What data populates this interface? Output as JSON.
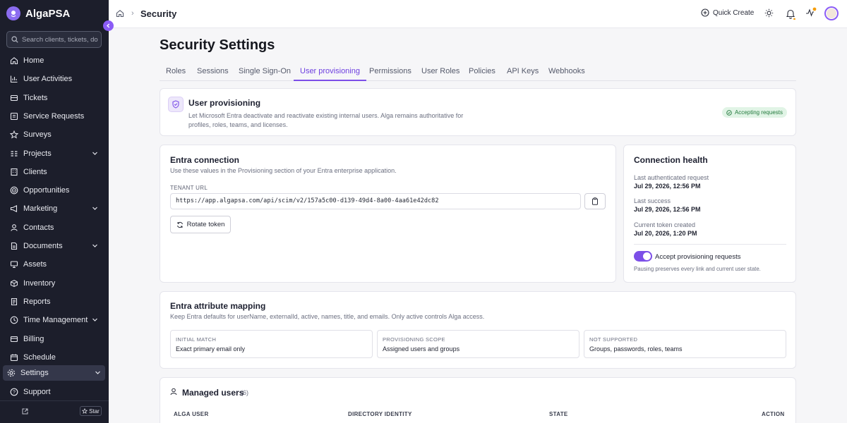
{
  "brand": {
    "name": "AlgaPSA"
  },
  "search": {
    "placeholder": "Search clients, tickets, documents..."
  },
  "sidebar": {
    "items": [
      {
        "label": "Home",
        "icon": "home-icon"
      },
      {
        "label": "User Activities",
        "icon": "chart-icon"
      },
      {
        "label": "Tickets",
        "icon": "ticket-icon"
      },
      {
        "label": "Service Requests",
        "icon": "service-icon"
      },
      {
        "label": "Surveys",
        "icon": "star-icon"
      },
      {
        "label": "Projects",
        "icon": "projects-icon",
        "expandable": true
      },
      {
        "label": "Clients",
        "icon": "building-icon"
      },
      {
        "label": "Opportunities",
        "icon": "target-icon"
      },
      {
        "label": "Marketing",
        "icon": "megaphone-icon",
        "expandable": true
      },
      {
        "label": "Contacts",
        "icon": "contacts-icon"
      },
      {
        "label": "Documents",
        "icon": "document-icon",
        "expandable": true
      },
      {
        "label": "Assets",
        "icon": "monitor-icon"
      },
      {
        "label": "Inventory",
        "icon": "box-icon"
      },
      {
        "label": "Reports",
        "icon": "report-icon"
      },
      {
        "label": "Time Management",
        "icon": "clock-icon",
        "expandable": true
      },
      {
        "label": "Billing",
        "icon": "billing-icon"
      },
      {
        "label": "Schedule",
        "icon": "calendar-icon"
      }
    ],
    "settings": {
      "label": "Settings"
    },
    "support": {
      "label": "Support"
    },
    "star": {
      "label": "Star"
    }
  },
  "header": {
    "title": "Security",
    "quick_create": "Quick Create"
  },
  "page": {
    "title": "Security Settings"
  },
  "tabs": [
    "Roles",
    "Sessions",
    "Single Sign-On",
    "User provisioning",
    "Permissions",
    "User Roles",
    "Policies",
    "API Keys",
    "Webhooks"
  ],
  "active_tab": "User provisioning",
  "provisioning": {
    "title": "User provisioning",
    "description_line1": "Let Microsoft Entra deactivate and reactivate existing internal users. Alga remains authoritative for",
    "description_line2": "profiles, roles, teams, and licenses.",
    "badge": "Accepting requests"
  },
  "entra": {
    "title": "Entra connection",
    "subtitle": "Use these values in the Provisioning section of your Entra enterprise application.",
    "tenant_url_label": "TENANT URL",
    "tenant_url": "https://app.algapsa.com/api/scim/v2/157a5c00-d139-49d4-8a00-4aa61e42dc82",
    "rotate_label": "Rotate token"
  },
  "health": {
    "title": "Connection health",
    "last_auth_label": "Last authenticated request",
    "last_auth_value": "Jul 29, 2026, 12:56 PM",
    "last_success_label": "Last success",
    "last_success_value": "Jul 29, 2026, 12:56 PM",
    "token_created_label": "Current token created",
    "token_created_value": "Jul 20, 2026, 1:20 PM",
    "toggle_label": "Accept provisioning requests",
    "toggle_on": true,
    "toggle_hint": "Pausing preserves every link and current user state."
  },
  "mapping": {
    "title": "Entra attribute mapping",
    "subtitle": "Keep Entra defaults for userName, externalId, active, names, title, and emails. Only active controls Alga access.",
    "boxes": [
      {
        "key": "INITIAL MATCH",
        "value": "Exact primary email only"
      },
      {
        "key": "PROVISIONING SCOPE",
        "value": "Assigned users and groups"
      },
      {
        "key": "NOT SUPPORTED",
        "value": "Groups, passwords, roles, teams"
      }
    ]
  },
  "managed": {
    "title": "Managed users",
    "count": "(6)",
    "columns": [
      "ALGA USER",
      "DIRECTORY IDENTITY",
      "STATE",
      "ACTION"
    ]
  },
  "colors": {
    "accent": "#7c4fe8",
    "sidebar_bg": "#1c1e2b",
    "success_bg": "#e1f4e6",
    "success_fg": "#237a3d"
  }
}
